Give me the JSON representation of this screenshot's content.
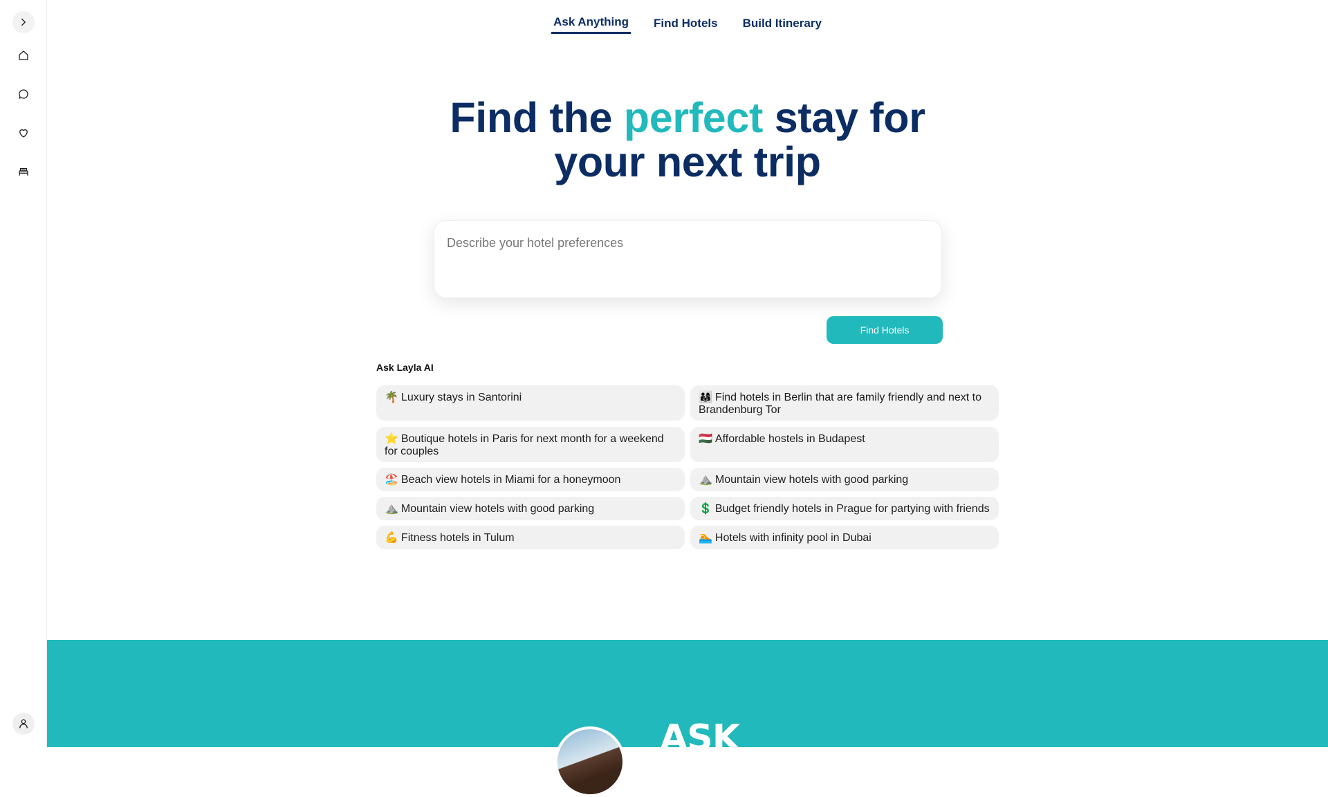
{
  "sidebar": {
    "toggle_icon": "chevron-right-icon",
    "items": [
      {
        "name": "home",
        "icon": "home-icon"
      },
      {
        "name": "chat",
        "icon": "chat-icon"
      },
      {
        "name": "favorites",
        "icon": "heart-icon"
      },
      {
        "name": "hotels",
        "icon": "bed-icon"
      }
    ],
    "user_icon": "user-icon"
  },
  "tabs": [
    {
      "label": "Ask Anything",
      "active": true
    },
    {
      "label": "Find Hotels",
      "active": false
    },
    {
      "label": "Build Itinerary",
      "active": false
    }
  ],
  "hero": {
    "headline_pre": "Find the ",
    "headline_accent": "perfect",
    "headline_post": " stay for",
    "headline_line2": "your next trip",
    "accent_color": "#22b9bc",
    "title_color": "#0b2d63"
  },
  "search": {
    "placeholder": "Describe your hotel preferences",
    "value": "",
    "button_label": "Find Hotels"
  },
  "suggestions": {
    "title": "Ask Layla AI",
    "items": [
      {
        "emoji": "🌴",
        "text": "Luxury stays in Santorini"
      },
      {
        "emoji": "👨‍👩‍👧",
        "text": "Find hotels in Berlin that are family friendly and next to Brandenburg Tor"
      },
      {
        "emoji": "⭐",
        "text": "Boutique hotels in Paris for next month for a weekend for couples"
      },
      {
        "emoji": "🇭🇺",
        "text": "Affordable hostels in Budapest"
      },
      {
        "emoji": "🏖️",
        "text": "Beach view hotels in Miami for a honeymoon"
      },
      {
        "emoji": "⛰️",
        "text": "Mountain view hotels with good parking"
      },
      {
        "emoji": "⛰️",
        "text": "Mountain view hotels with good parking"
      },
      {
        "emoji": "💲",
        "text": "Budget friendly hotels in Prague for partying with friends"
      },
      {
        "emoji": "💪",
        "text": "Fitness hotels in Tulum"
      },
      {
        "emoji": "🏊",
        "text": "Hotels with infinity pool in Dubai"
      }
    ]
  },
  "promo": {
    "logo_text": "ASK",
    "background": "#22b9bc"
  }
}
